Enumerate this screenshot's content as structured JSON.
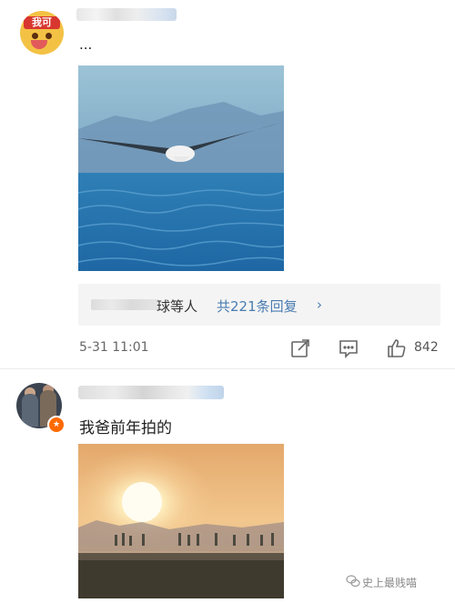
{
  "comment1": {
    "avatar_badge": "我可",
    "text": "...",
    "replies": {
      "names_suffix": "球等人",
      "count_label": "共221条回复",
      "chevron": "›"
    },
    "timestamp": "5-31 11:01",
    "likes": "842"
  },
  "comment2": {
    "avatar_badge": "★",
    "text": "我爸前年拍的"
  },
  "watermark": "史上最贱喵"
}
